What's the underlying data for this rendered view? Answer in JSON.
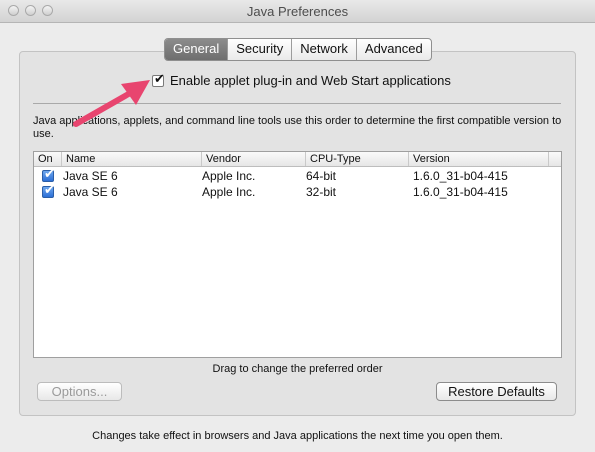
{
  "window": {
    "title": "Java Preferences"
  },
  "tabs": [
    {
      "label": "General",
      "active": true
    },
    {
      "label": "Security",
      "active": false
    },
    {
      "label": "Network",
      "active": false
    },
    {
      "label": "Advanced",
      "active": false
    }
  ],
  "enable_checkbox": {
    "label": "Enable applet plug-in and Web Start applications",
    "checked": true
  },
  "description": "Java applications, applets, and command line tools use this order to determine the first compatible version to use.",
  "table": {
    "columns": [
      "On",
      "Name",
      "Vendor",
      "CPU-Type",
      "Version"
    ],
    "rows": [
      {
        "on": true,
        "name": "Java SE 6",
        "vendor": "Apple Inc.",
        "cpu": "64-bit",
        "version": "1.6.0_31-b04-415"
      },
      {
        "on": true,
        "name": "Java SE 6",
        "vendor": "Apple Inc.",
        "cpu": "32-bit",
        "version": "1.6.0_31-b04-415"
      }
    ]
  },
  "drag_hint": "Drag to change the preferred order",
  "buttons": {
    "options": "Options...",
    "restore_defaults": "Restore Defaults"
  },
  "footer": "Changes take effect in browsers and Java applications the next time you open them.",
  "annotation": {
    "arrow_color": "#e8456f"
  }
}
